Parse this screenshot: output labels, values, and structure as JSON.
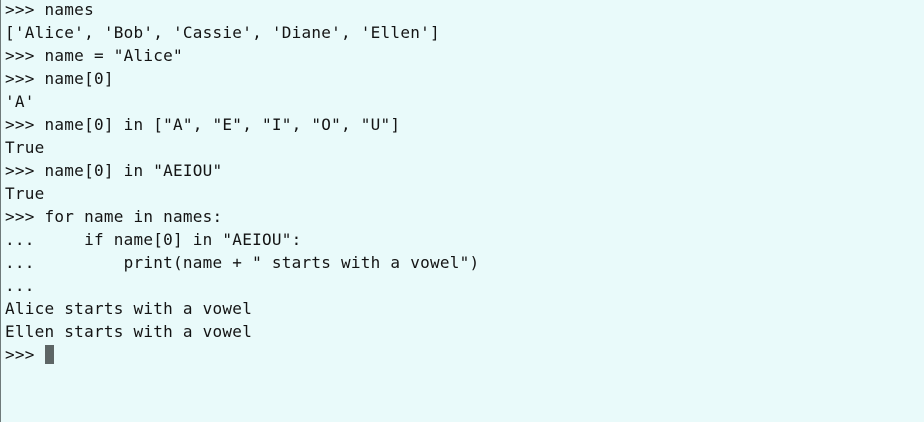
{
  "terminal": {
    "lines": [
      ">>> names",
      "['Alice', 'Bob', 'Cassie', 'Diane', 'Ellen']",
      ">>> name = \"Alice\"",
      ">>> name[0]",
      "'A'",
      ">>> name[0] in [\"A\", \"E\", \"I\", \"O\", \"U\"]",
      "True",
      ">>> name[0] in \"AEIOU\"",
      "True",
      ">>> for name in names:",
      "...     if name[0] in \"AEIOU\":",
      "...         print(name + \" starts with a vowel\")",
      "...",
      "Alice starts with a vowel",
      "Ellen starts with a vowel"
    ],
    "prompt": ">>> "
  }
}
